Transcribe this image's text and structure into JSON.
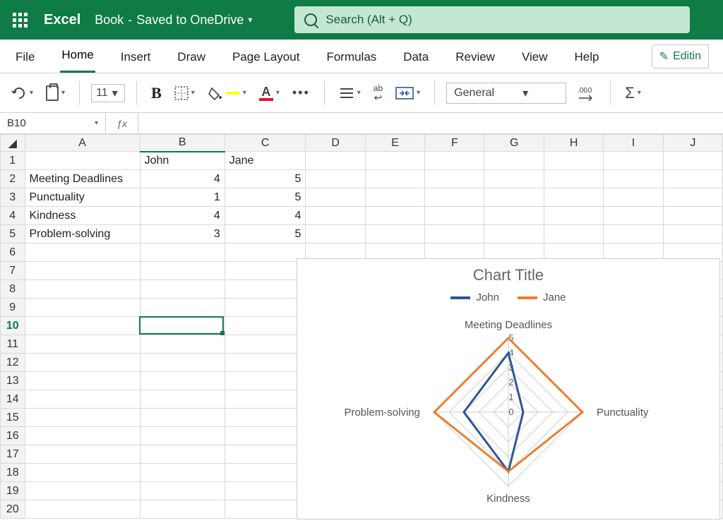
{
  "titlebar": {
    "app_name": "Excel",
    "doc_name": "Book",
    "save_status": "Saved to OneDrive",
    "search_placeholder": "Search (Alt + Q)"
  },
  "tabs": {
    "items": [
      "File",
      "Home",
      "Insert",
      "Draw",
      "Page Layout",
      "Formulas",
      "Data",
      "Review",
      "View",
      "Help"
    ],
    "active": "Home",
    "editing_label": "Editin"
  },
  "toolbar": {
    "font_size": "11",
    "number_format": "General"
  },
  "namebox": {
    "value": "B10"
  },
  "columns": [
    "A",
    "B",
    "C",
    "D",
    "E",
    "F",
    "G",
    "H",
    "I",
    "J"
  ],
  "rows": [
    1,
    2,
    3,
    4,
    5,
    6,
    7,
    8,
    9,
    10,
    11,
    12,
    13,
    14,
    15,
    16,
    17,
    18,
    19,
    20
  ],
  "cells": {
    "B1": "John",
    "C1": "Jane",
    "A2": "Meeting Deadlines",
    "B2": "4",
    "C2": "5",
    "A3": "Punctuality",
    "B3": "1",
    "C3": "5",
    "A4": "Kindness",
    "B4": "4",
    "C4": "4",
    "A5": "Problem-solving",
    "B5": "3",
    "C5": "5"
  },
  "active_cell": "B10",
  "chart": {
    "title": "Chart Title",
    "legend": [
      "John",
      "Jane"
    ],
    "colors": {
      "John": "#2f5597",
      "Jane": "#ed7d31"
    },
    "axis_labels": [
      "Meeting Deadlines",
      "Punctuality",
      "Kindness",
      "Problem-solving"
    ],
    "ticks": [
      0,
      1,
      2,
      3,
      4,
      5
    ]
  },
  "chart_data": {
    "type": "radar",
    "title": "Chart Title",
    "categories": [
      "Meeting Deadlines",
      "Punctuality",
      "Kindness",
      "Problem-solving"
    ],
    "max": 5,
    "ticks": [
      0,
      1,
      2,
      3,
      4,
      5
    ],
    "series": [
      {
        "name": "John",
        "color": "#2f5597",
        "values": [
          4,
          1,
          4,
          3
        ]
      },
      {
        "name": "Jane",
        "color": "#ed7d31",
        "values": [
          5,
          5,
          4,
          5
        ]
      }
    ]
  }
}
